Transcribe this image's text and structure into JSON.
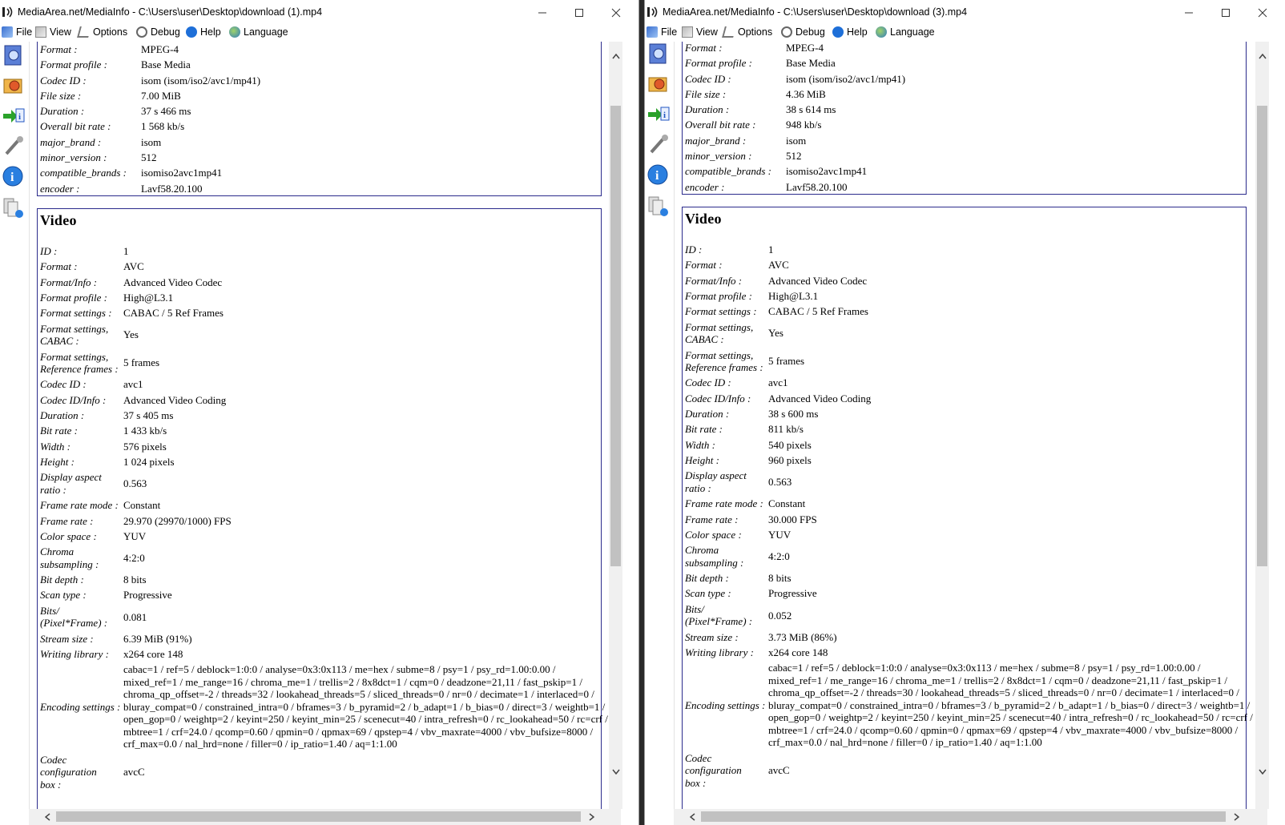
{
  "left": {
    "title": "MediaArea.net/MediaInfo - C:\\Users\\user\\Desktop\\download (1).mp4",
    "menu": [
      "File",
      "View",
      "Options",
      "Debug",
      "Help",
      "Language"
    ],
    "general": [
      [
        "Format :",
        "MPEG-4"
      ],
      [
        "Format profile :",
        "Base Media"
      ],
      [
        "Codec ID :",
        "isom (isom/iso2/avc1/mp41)"
      ],
      [
        "File size :",
        "7.00 MiB"
      ],
      [
        "Duration :",
        "37 s 466 ms"
      ],
      [
        "Overall bit rate :",
        "1 568 kb/s"
      ],
      [
        "major_brand :",
        "isom"
      ],
      [
        "minor_version :",
        "512"
      ],
      [
        "compatible_brands :",
        "isomiso2avc1mp41"
      ],
      [
        "encoder :",
        "Lavf58.20.100"
      ]
    ],
    "video_title": "Video",
    "video": [
      [
        "ID :",
        "1"
      ],
      [
        "Format :",
        "AVC"
      ],
      [
        "Format/Info :",
        "Advanced Video Codec"
      ],
      [
        "Format profile :",
        "High@L3.1"
      ],
      [
        "Format settings :",
        "CABAC / 5 Ref Frames"
      ],
      [
        "Format settings,\nCABAC :",
        "Yes"
      ],
      [
        "Format settings,\nReference frames :",
        "5 frames"
      ],
      [
        "Codec ID :",
        "avc1"
      ],
      [
        "Codec ID/Info :",
        "Advanced Video Coding"
      ],
      [
        "Duration :",
        "37 s 405 ms"
      ],
      [
        "Bit rate :",
        "1 433 kb/s"
      ],
      [
        "Width :",
        "576 pixels"
      ],
      [
        "Height :",
        "1 024 pixels"
      ],
      [
        "Display aspect\nratio :",
        "0.563"
      ],
      [
        "Frame rate mode :",
        "Constant"
      ],
      [
        "Frame rate :",
        "29.970 (29970/1000) FPS"
      ],
      [
        "Color space :",
        "YUV"
      ],
      [
        "Chroma\nsubsampling :",
        "4:2:0"
      ],
      [
        "Bit depth :",
        "8 bits"
      ],
      [
        "Scan type :",
        "Progressive"
      ],
      [
        "Bits/\n(Pixel*Frame) :",
        "0.081"
      ],
      [
        "Stream size :",
        "6.39 MiB (91%)"
      ],
      [
        "Writing library :",
        "x264 core 148"
      ],
      [
        "Encoding settings :",
        "cabac=1 / ref=5 / deblock=1:0:0 / analyse=0x3:0x113 / me=hex / subme=8 / psy=1 / psy_rd=1.00:0.00 /\nmixed_ref=1 / me_range=16 / chroma_me=1 / trellis=2 / 8x8dct=1 / cqm=0 / deadzone=21,11 / fast_pskip=1 /\nchroma_qp_offset=-2 / threads=32 / lookahead_threads=5 / sliced_threads=0 / nr=0 / decimate=1 / interlaced=0 /\nbluray_compat=0 / constrained_intra=0 / bframes=3 / b_pyramid=2 / b_adapt=1 / b_bias=0 / direct=3 / weightb=1 /\nopen_gop=0 / weightp=2 / keyint=250 / keyint_min=25 / scenecut=40 / intra_refresh=0 / rc_lookahead=50 / rc=crf /\nmbtree=1 / crf=24.0 / qcomp=0.60 / qpmin=0 / qpmax=69 / qpstep=4 / vbv_maxrate=4000 / vbv_bufsize=8000 /\ncrf_max=0.0 / nal_hrd=none / filler=0 / ip_ratio=1.40 / aq=1:1.00"
      ],
      [
        "Codec\nconfiguration\nbox :",
        "avcC"
      ]
    ]
  },
  "right": {
    "title": "MediaArea.net/MediaInfo - C:\\Users\\user\\Desktop\\download (3).mp4",
    "menu": [
      "File",
      "View",
      "Options",
      "Debug",
      "Help",
      "Language"
    ],
    "general": [
      [
        "Format :",
        "MPEG-4"
      ],
      [
        "Format profile :",
        "Base Media"
      ],
      [
        "Codec ID :",
        "isom (isom/iso2/avc1/mp41)"
      ],
      [
        "File size :",
        "4.36 MiB"
      ],
      [
        "Duration :",
        "38 s 614 ms"
      ],
      [
        "Overall bit rate :",
        "948 kb/s"
      ],
      [
        "major_brand :",
        "isom"
      ],
      [
        "minor_version :",
        "512"
      ],
      [
        "compatible_brands :",
        "isomiso2avc1mp41"
      ],
      [
        "encoder :",
        "Lavf58.20.100"
      ]
    ],
    "video_title": "Video",
    "video": [
      [
        "ID :",
        "1"
      ],
      [
        "Format :",
        "AVC"
      ],
      [
        "Format/Info :",
        "Advanced Video Codec"
      ],
      [
        "Format profile :",
        "High@L3.1"
      ],
      [
        "Format settings :",
        "CABAC / 5 Ref Frames"
      ],
      [
        "Format settings,\nCABAC :",
        "Yes"
      ],
      [
        "Format settings,\nReference frames :",
        "5 frames"
      ],
      [
        "Codec ID :",
        "avc1"
      ],
      [
        "Codec ID/Info :",
        "Advanced Video Coding"
      ],
      [
        "Duration :",
        "38 s 600 ms"
      ],
      [
        "Bit rate :",
        "811 kb/s"
      ],
      [
        "Width :",
        "540 pixels"
      ],
      [
        "Height :",
        "960 pixels"
      ],
      [
        "Display aspect\nratio :",
        "0.563"
      ],
      [
        "Frame rate mode :",
        "Constant"
      ],
      [
        "Frame rate :",
        "30.000 FPS"
      ],
      [
        "Color space :",
        "YUV"
      ],
      [
        "Chroma\nsubsampling :",
        "4:2:0"
      ],
      [
        "Bit depth :",
        "8 bits"
      ],
      [
        "Scan type :",
        "Progressive"
      ],
      [
        "Bits/\n(Pixel*Frame) :",
        "0.052"
      ],
      [
        "Stream size :",
        "3.73 MiB (86%)"
      ],
      [
        "Writing library :",
        "x264 core 148"
      ],
      [
        "Encoding settings :",
        "cabac=1 / ref=5 / deblock=1:0:0 / analyse=0x3:0x113 / me=hex / subme=8 / psy=1 / psy_rd=1.00:0.00 /\nmixed_ref=1 / me_range=16 / chroma_me=1 / trellis=2 / 8x8dct=1 / cqm=0 / deadzone=21,11 / fast_pskip=1 /\nchroma_qp_offset=-2 / threads=30 / lookahead_threads=5 / sliced_threads=0 / nr=0 / decimate=1 / interlaced=0 /\nbluray_compat=0 / constrained_intra=0 / bframes=3 / b_pyramid=2 / b_adapt=1 / b_bias=0 / direct=3 / weightb=1 /\nopen_gop=0 / weightp=2 / keyint=250 / keyint_min=25 / scenecut=40 / intra_refresh=0 / rc_lookahead=50 / rc=crf /\nmbtree=1 / crf=24.0 / qcomp=0.60 / qpmin=0 / qpmax=69 / qpstep=4 / vbv_maxrate=4000 / vbv_bufsize=8000 /\ncrf_max=0.0 / nal_hrd=none / filler=0 / ip_ratio=1.40 / aq=1:1.00"
      ],
      [
        "Codec\nconfiguration\nbox :",
        "avcC"
      ]
    ]
  },
  "icons": {
    "menu": [
      "file-icon",
      "view-icon",
      "options-icon",
      "debug-icon",
      "help-icon",
      "language-icon"
    ],
    "toolbar": [
      "open-file-icon",
      "open-folder-icon",
      "export-icon",
      "settings-icon",
      "about-icon",
      "knowledge-icon"
    ]
  },
  "colors": {
    "section_border": "#2b2b8c",
    "accent": "#1565c0"
  }
}
